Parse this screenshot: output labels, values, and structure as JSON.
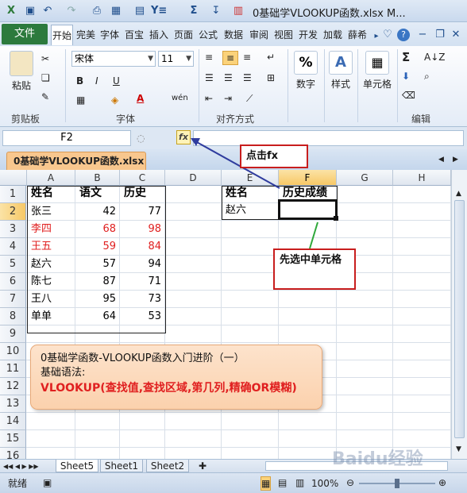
{
  "window": {
    "title": "0基础学VLOOKUP函数.xlsx M...",
    "quick_access": [
      "save-icon",
      "undo-icon",
      "redo-icon",
      "print-preview-icon",
      "border-icon",
      "calc-icon",
      "filter-icon",
      "sum-icon",
      "sort-icon",
      "chart-icon"
    ]
  },
  "ribbon": {
    "file_tab": "文件",
    "tabs": [
      "开始",
      "完美",
      "字体",
      "百宝",
      "插入",
      "页面",
      "公式",
      "数据",
      "审阅",
      "视图",
      "开发",
      "加载",
      "薛希"
    ],
    "active_tab": "开始",
    "clipboard": {
      "label": "剪贴板",
      "paste": "粘贴"
    },
    "font": {
      "label": "字体",
      "name": "宋体",
      "size": "11",
      "bold": "B",
      "italic": "I",
      "underline": "U",
      "color_glyph": "A",
      "pinyin": "wén"
    },
    "alignment": {
      "label": "对齐方式"
    },
    "number": {
      "label": "数字",
      "glyph": "%"
    },
    "style": {
      "label": "样式",
      "glyph": "A"
    },
    "cells": {
      "label": "单元格"
    },
    "edit": {
      "label": "编辑",
      "glyph": "Σ"
    }
  },
  "formula_bar": {
    "name_box": "F2",
    "fx_label": "fx",
    "value": ""
  },
  "workbook_tab": "0基础学VLOOKUP函数.xlsx",
  "grid": {
    "columns": [
      "A",
      "B",
      "C",
      "D",
      "E",
      "F",
      "G",
      "H"
    ],
    "selected_column": "F",
    "rows": [
      "1",
      "2",
      "3",
      "4",
      "5",
      "6",
      "7",
      "8",
      "9",
      "10",
      "11",
      "12",
      "13",
      "14",
      "15",
      "16",
      "17",
      "18"
    ],
    "selected_row": "2",
    "headers": [
      "姓名",
      "语文",
      "历史"
    ],
    "records": [
      {
        "name": "张三",
        "yuwen": "42",
        "lishi": "77",
        "red": false
      },
      {
        "name": "李四",
        "yuwen": "68",
        "lishi": "98",
        "red": true
      },
      {
        "name": "王五",
        "yuwen": "59",
        "lishi": "84",
        "red": true
      },
      {
        "name": "赵六",
        "yuwen": "57",
        "lishi": "94",
        "red": false
      },
      {
        "name": "陈七",
        "yuwen": "87",
        "lishi": "71",
        "red": false
      },
      {
        "name": "王八",
        "yuwen": "95",
        "lishi": "73",
        "red": false
      },
      {
        "name": "单单",
        "yuwen": "64",
        "lishi": "53",
        "red": false
      }
    ],
    "lookup": {
      "name_header": "姓名",
      "result_header": "历史成绩",
      "name_value": "赵六",
      "result_value": ""
    }
  },
  "annotations": {
    "click_fx": "点击fx",
    "select_cell": "先选中单元格",
    "info": {
      "line1": "0基础学函数-VLOOKUP函数入门进阶（一）",
      "line2": "基础语法:",
      "syntax": "VLOOKUP(查找值,查找区域,第几列,精确OR模糊)"
    }
  },
  "sheet_tabs": [
    "Sheet5",
    "Sheet1",
    "Sheet2"
  ],
  "active_sheet": "Sheet5",
  "status": {
    "mode": "就绪",
    "zoom": "100%"
  },
  "watermark": "Baidu经验"
}
